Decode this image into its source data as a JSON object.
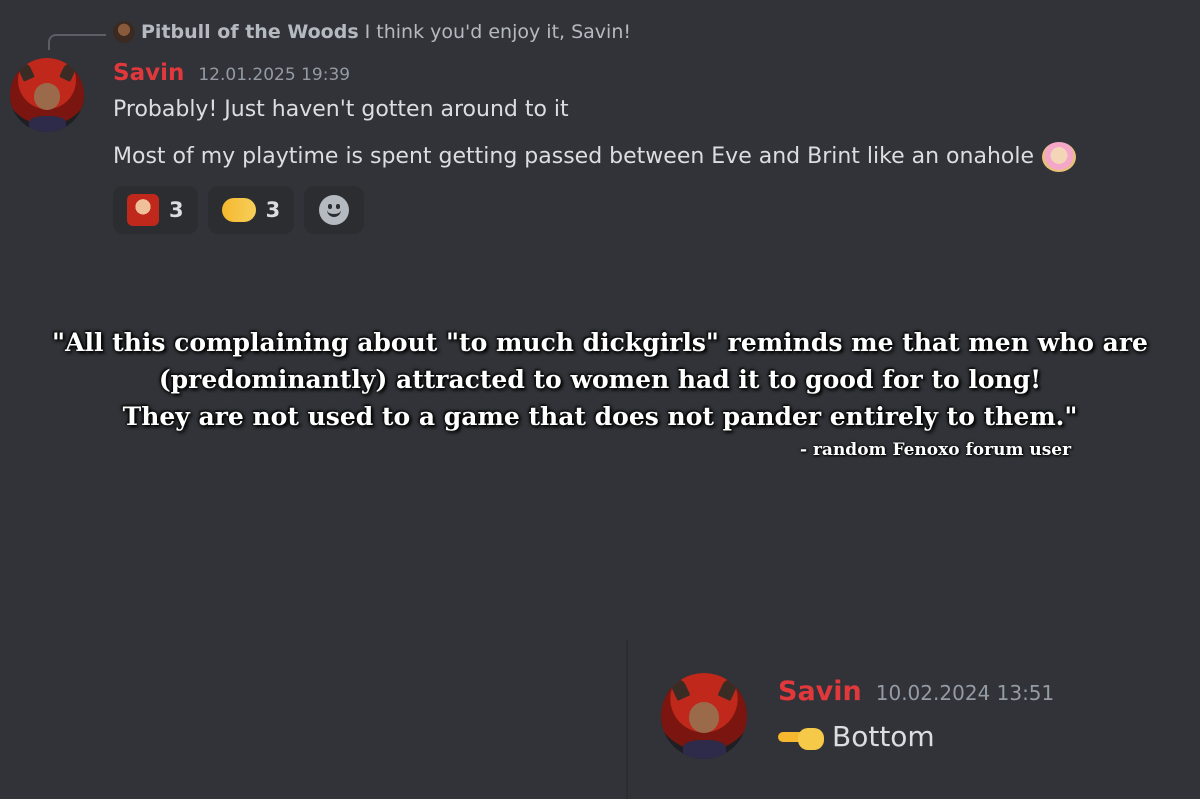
{
  "reply": {
    "author": "Pitbull of the Woods",
    "text": "I think you'd enjoy it, Savin!"
  },
  "message1": {
    "username": "Savin",
    "timestamp": "12.01.2025 19:39",
    "lines": [
      "Probably! Just haven't gotten around to it",
      "Most of my playtime is spent getting passed between Eve and Brint like an onahole"
    ],
    "reactions": [
      {
        "icon": "character-emoji-icon",
        "count": "3"
      },
      {
        "icon": "handshake-icon",
        "count": "3"
      }
    ],
    "add_reaction_icon": "smile-add-reaction-icon"
  },
  "overlay": {
    "quote_lines": [
      "\"All this complaining about \"to much dickgirls\" reminds me that men who are",
      "(predominantly) attracted to women had it to good for to long!",
      "They are not used to a game that does not pander entirely to them.\""
    ],
    "attribution": "- random Fenoxo forum user"
  },
  "message2": {
    "username": "Savin",
    "timestamp": "10.02.2024 13:51",
    "text": "Bottom",
    "icon": "pointing-hand-icon"
  },
  "colors": {
    "background": "#313338",
    "username": "#e0383b",
    "timestamp": "#949ba4",
    "text": "#dbdee1",
    "reaction_bg": "#2b2d31"
  }
}
